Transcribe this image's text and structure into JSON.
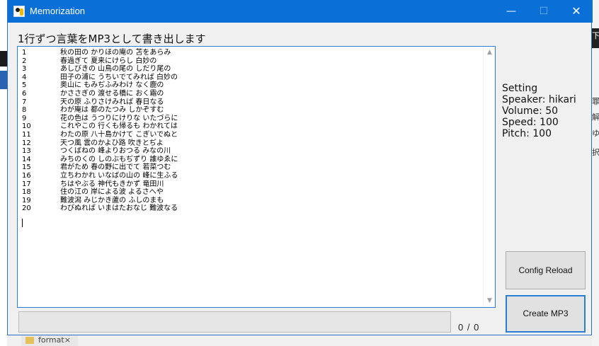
{
  "window": {
    "title": "Memorization",
    "minimize_glyph": "—",
    "maximize_glyph": "☐",
    "close_glyph": "✕"
  },
  "header": {
    "label": "1行ずつ言葉をMP3として書き出します"
  },
  "editor": {
    "lines": [
      {
        "num": "1",
        "text": "秋の田の かりほの庵の 苫をあらみ"
      },
      {
        "num": "2",
        "text": "春過ぎて 夏来にけらし 白妙の"
      },
      {
        "num": "3",
        "text": "あしびきの 山鳥の尾の しだり尾の"
      },
      {
        "num": "4",
        "text": "田子の浦に うちいでてみれば 白妙の"
      },
      {
        "num": "5",
        "text": "奥山に もみぢふみわけ なく鹿の"
      },
      {
        "num": "6",
        "text": "かささぎの 渡せる橋に おく霜の"
      },
      {
        "num": "7",
        "text": "天の原 ふりさけみれば 春日なる"
      },
      {
        "num": "8",
        "text": "わが庵は 都のたつみ しかぞすむ"
      },
      {
        "num": "9",
        "text": "花の色は うつりにけりな いたづらに"
      },
      {
        "num": "10",
        "text": "これやこの 行くも帰るも わかれては"
      },
      {
        "num": "11",
        "text": "わたの原 八十島かけて こぎいでぬと"
      },
      {
        "num": "12",
        "text": "天つ風 雲のかよひ路 吹きとぢよ"
      },
      {
        "num": "13",
        "text": "つくばねの 峰よりおつる みなの川"
      },
      {
        "num": "14",
        "text": "みちのくの しのぶもぢずり 誰ゆゑに"
      },
      {
        "num": "15",
        "text": "君がため 春の野に出でて 若菜つむ"
      },
      {
        "num": "16",
        "text": "立ちわかれ いなばの山の 峰に生ふる"
      },
      {
        "num": "17",
        "text": "ちはやぶる 神代もきかず 竜田川"
      },
      {
        "num": "18",
        "text": "住の江の 岸による波 よるさへや"
      },
      {
        "num": "19",
        "text": "難波潟 みじかき蘆の ふしのまも"
      },
      {
        "num": "20",
        "text": "わびぬれば いまはたおなじ 難波なる"
      }
    ]
  },
  "settings": {
    "heading": "Setting",
    "speaker": "Speaker: hikari",
    "volume": "Volume: 50",
    "speed": "Speed: 100",
    "pitch": "Pitch: 100"
  },
  "progress": {
    "fraction": 0,
    "counter": "0 / 0"
  },
  "buttons": {
    "config_reload": "Config Reload",
    "create_mp3": "Create MP3"
  },
  "background": {
    "tab_label": "format",
    "tab_close": "×",
    "right_frags": [
      "罪",
      "解",
      "ゆ",
      "択"
    ],
    "right_top_glyph": "下"
  },
  "colors": {
    "titlebar": "#0a6fd6",
    "focus_border": "#2a7fd4",
    "button_face": "#e1e1e1"
  }
}
